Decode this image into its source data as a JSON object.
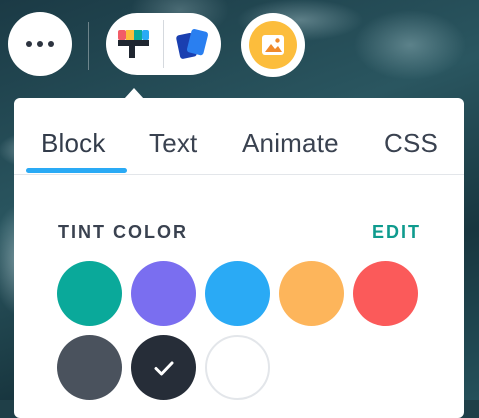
{
  "toolbar": {
    "more_icon": "more-horizontal-icon",
    "brush_icon": "paint-brush-icon",
    "cards_icon": "layers-cards-icon",
    "image_icon": "image-icon"
  },
  "panel": {
    "tabs": [
      {
        "label": "Block",
        "active": true
      },
      {
        "label": "Text",
        "active": false
      },
      {
        "label": "Animate",
        "active": false
      },
      {
        "label": "CSS",
        "active": false
      }
    ],
    "tint": {
      "title": "TINT COLOR",
      "edit_label": "EDIT",
      "swatches": [
        {
          "color": "#0aa99a",
          "selected": false
        },
        {
          "color": "#7a6ef0",
          "selected": false
        },
        {
          "color": "#2aaaf5",
          "selected": false
        },
        {
          "color": "#fdb55b",
          "selected": false
        },
        {
          "color": "#fb5a5a",
          "selected": false
        },
        {
          "color": "#4a525d",
          "selected": false
        },
        {
          "color": "#262d38",
          "selected": true
        },
        {
          "color": "#ffffff",
          "selected": false
        }
      ]
    }
  },
  "colors": {
    "accent": "#2aaaf5",
    "edit": "#0f9b8e",
    "image_button": "#fcbd3c"
  }
}
